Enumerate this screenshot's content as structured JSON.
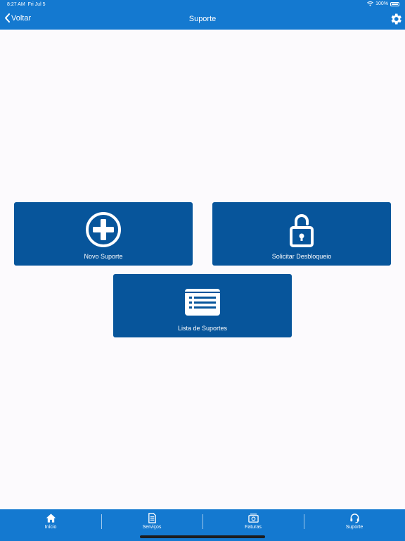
{
  "status_bar": {
    "time": "8:27 AM",
    "date": "Fri Jul 5",
    "battery": "100%"
  },
  "nav": {
    "back_label": "Voltar",
    "title": "Suporte"
  },
  "tiles": [
    {
      "label": "Novo Suporte",
      "icon": "plus-circle-icon"
    },
    {
      "label": "Solicitar Desbloqueio",
      "icon": "unlock-icon"
    },
    {
      "label": "Lista de Suportes",
      "icon": "list-icon"
    }
  ],
  "tabbar": {
    "items": [
      {
        "label": "Início",
        "icon": "home-icon"
      },
      {
        "label": "Serviços",
        "icon": "document-icon"
      },
      {
        "label": "Faturas",
        "icon": "money-icon"
      },
      {
        "label": "Suporte",
        "icon": "headset-icon"
      }
    ]
  },
  "colors": {
    "bar": "#1479d0",
    "tile": "#07559b",
    "background": "#fcfafd"
  }
}
